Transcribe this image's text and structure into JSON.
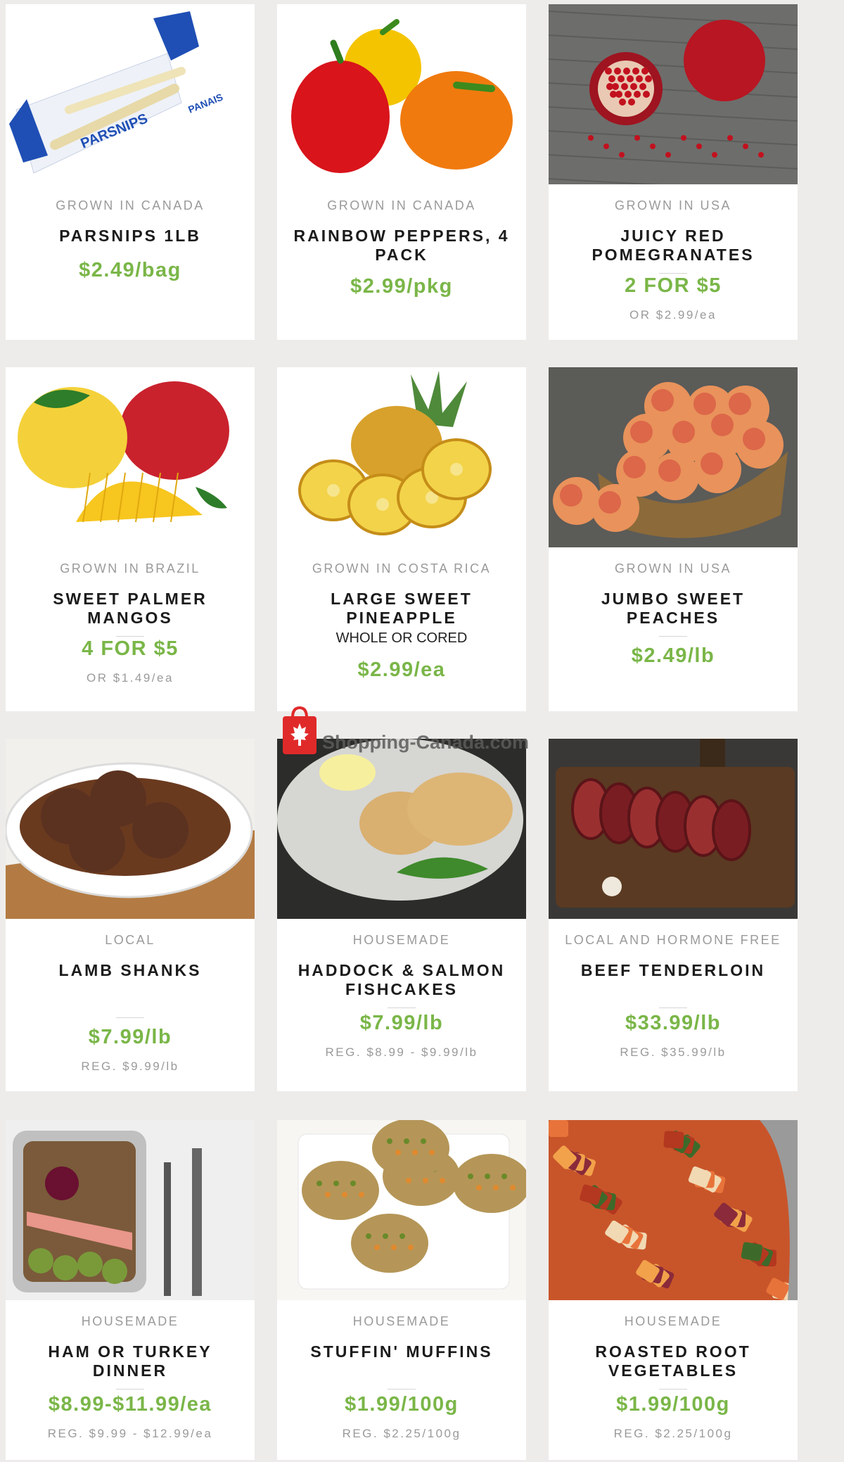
{
  "products": [
    {
      "origin": "GROWN IN CANADA",
      "name": "PARSNIPS 1LB",
      "price": "$2.49/bag",
      "note": "",
      "sub": "",
      "image": "parsnips-bag-image"
    },
    {
      "origin": "GROWN IN CANADA",
      "name": "RAINBOW PEPPERS, 4 PACK",
      "price": "$2.99/pkg",
      "note": "",
      "sub": "",
      "image": "peppers-image"
    },
    {
      "origin": "GROWN IN USA",
      "name": "JUICY RED POMEGRANATES",
      "price": "2 FOR $5",
      "note": "",
      "sub": "OR $2.99/ea",
      "image": "pomegranate-image"
    },
    {
      "origin": "GROWN IN BRAZIL",
      "name": "SWEET PALMER MANGOS",
      "price": "4 FOR $5",
      "note": "",
      "sub": "OR $1.49/ea",
      "image": "mango-image"
    },
    {
      "origin": "GROWN IN COSTA RICA",
      "name": "LARGE SWEET PINEAPPLE",
      "price": "$2.99/ea",
      "note": "WHOLE OR CORED",
      "sub": "",
      "image": "pineapple-image"
    },
    {
      "origin": "GROWN IN USA",
      "name": "JUMBO SWEET PEACHES",
      "price": "$2.49/lb",
      "note": "",
      "sub": "",
      "image": "peaches-image"
    },
    {
      "origin": "LOCAL",
      "name": "LAMB SHANKS",
      "price": "$7.99/lb",
      "note": "",
      "sub": "REG. $9.99/lb",
      "image": "lamb-shanks-image"
    },
    {
      "origin": "HOUSEMADE",
      "name": "HADDOCK & SALMON FISHCAKES",
      "price": "$7.99/lb",
      "note": "",
      "sub": "REG. $8.99 - $9.99/lb",
      "image": "fishcakes-image"
    },
    {
      "origin": "LOCAL AND HORMONE FREE",
      "name": "BEEF TENDERLOIN",
      "price": "$33.99/lb",
      "note": "",
      "sub": "REG. $35.99/lb",
      "image": "beef-tenderloin-image"
    },
    {
      "origin": "HOUSEMADE",
      "name": "HAM OR TURKEY DINNER",
      "price": "$8.99-$11.99/ea",
      "note": "",
      "sub": "REG. $9.99 - $12.99/ea",
      "image": "dinner-tray-image"
    },
    {
      "origin": "HOUSEMADE",
      "name": "STUFFIN' MUFFINS",
      "price": "$1.99/100g",
      "note": "",
      "sub": "REG. $2.25/100g",
      "image": "stuffin-muffins-image"
    },
    {
      "origin": "HOUSEMADE",
      "name": "ROASTED ROOT VEGETABLES",
      "price": "$1.99/100g",
      "note": "",
      "sub": "REG. $2.25/100g",
      "image": "roasted-vegetables-image"
    }
  ],
  "image_labels": {
    "parsnips_bag": "PARSNIPS",
    "parsnips_bag_fr": "PANAIS"
  },
  "watermark": {
    "text": "Shopping-Canada.com",
    "icon": "maple-leaf-bag-icon"
  },
  "colors": {
    "price": "#7ab648",
    "page_bg": "#eeecea",
    "card_bg": "#ffffff",
    "watermark_red": "#e02a2a"
  }
}
